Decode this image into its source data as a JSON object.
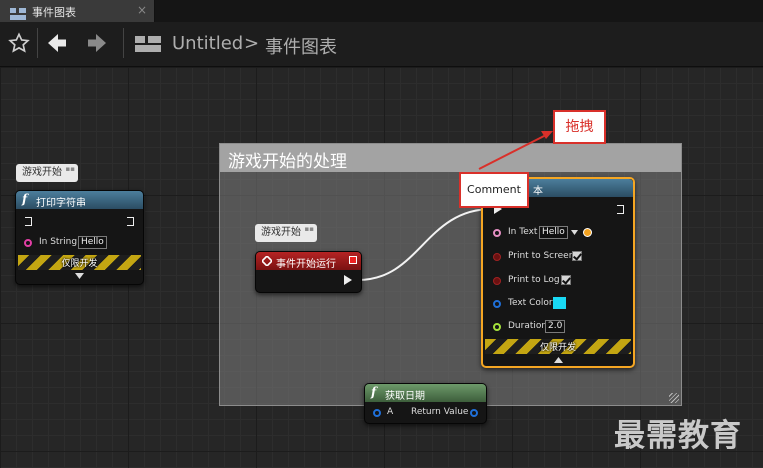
{
  "tab": {
    "label": "事件图表",
    "close": "×",
    "icon": "graph-icon"
  },
  "toolbar": {
    "bookmark_icon": "star-icon",
    "back_icon": "arrow-left-icon",
    "forward_icon": "arrow-right-icon",
    "graph_icon": "graph-icon",
    "breadcrumb_root": "Untitled",
    "breadcrumb_sep": ">",
    "breadcrumb_current": "事件图表"
  },
  "comment_box": {
    "title": "游戏开始的处理"
  },
  "left_node": {
    "bubble": "游戏开始",
    "title": "打印字符串",
    "pin_in_string_label": "In String",
    "pin_in_string_value": "Hello",
    "dev_only": "仅限开发"
  },
  "event_node": {
    "bubble": "游戏开始",
    "title": "事件开始运行"
  },
  "print_node": {
    "title_suffix": "本",
    "in_text_label": "In Text",
    "in_text_value": "Hello",
    "print_to_screen_label": "Print to Screen",
    "print_to_screen": true,
    "print_to_log_label": "Print to Log",
    "print_to_log": true,
    "text_color_label": "Text Color",
    "text_color_value": "#19d9f4",
    "duration_label": "Duration",
    "duration_value": "2.0",
    "dev_only": "仅限开发"
  },
  "date_node": {
    "title": "获取日期",
    "pin_a": "A",
    "pin_return": "Return Value"
  },
  "annotations": {
    "drag_label": "拖拽",
    "comment_popup": "Comment",
    "accent_color": "#d9302a"
  },
  "watermark": "最需教育"
}
